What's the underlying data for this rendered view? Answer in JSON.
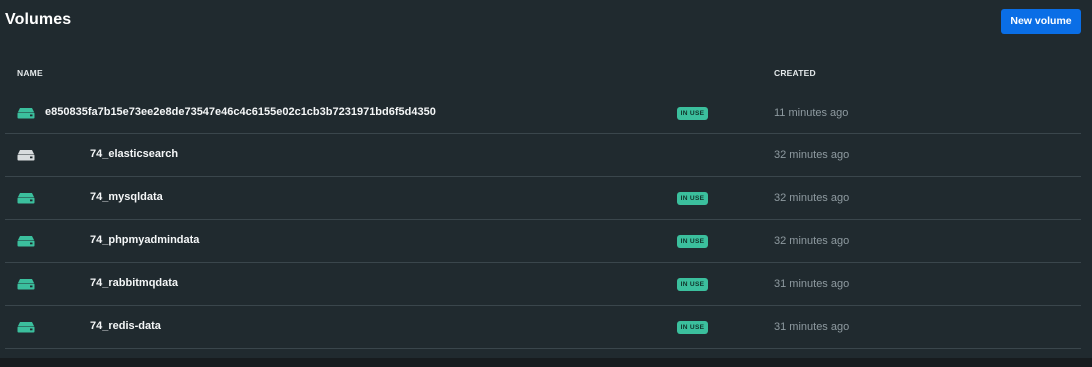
{
  "header": {
    "title": "Volumes",
    "new_button_label": "New volume"
  },
  "table": {
    "columns": {
      "name": "NAME",
      "created": "CREATED"
    },
    "rows": [
      {
        "name": "e850835fa7b15e73ee2e8de73547e46c4c6155e02c1cb3b7231971bd6f5d4350",
        "in_use": true,
        "badge": "IN USE",
        "created": "11 minutes ago",
        "icon": "drive-icon",
        "icon_color": "#3bbf9d"
      },
      {
        "name": "74_elasticsearch",
        "in_use": false,
        "badge": "",
        "created": "32 minutes ago",
        "icon": "drive-icon",
        "icon_color": "#d8dcde"
      },
      {
        "name": "74_mysqldata",
        "in_use": true,
        "badge": "IN USE",
        "created": "32 minutes ago",
        "icon": "drive-icon",
        "icon_color": "#3bbf9d"
      },
      {
        "name": "74_phpmyadmindata",
        "in_use": true,
        "badge": "IN USE",
        "created": "32 minutes ago",
        "icon": "drive-icon",
        "icon_color": "#3bbf9d"
      },
      {
        "name": "74_rabbitmqdata",
        "in_use": true,
        "badge": "IN USE",
        "created": "31 minutes ago",
        "icon": "drive-icon",
        "icon_color": "#3bbf9d"
      },
      {
        "name": "74_redis-data",
        "in_use": true,
        "badge": "IN USE",
        "created": "31 minutes ago",
        "icon": "drive-icon",
        "icon_color": "#3bbf9d"
      }
    ]
  },
  "colors": {
    "accent": "#0a6ee6",
    "badge": "#3bbf9d",
    "background": "#202a2f"
  }
}
